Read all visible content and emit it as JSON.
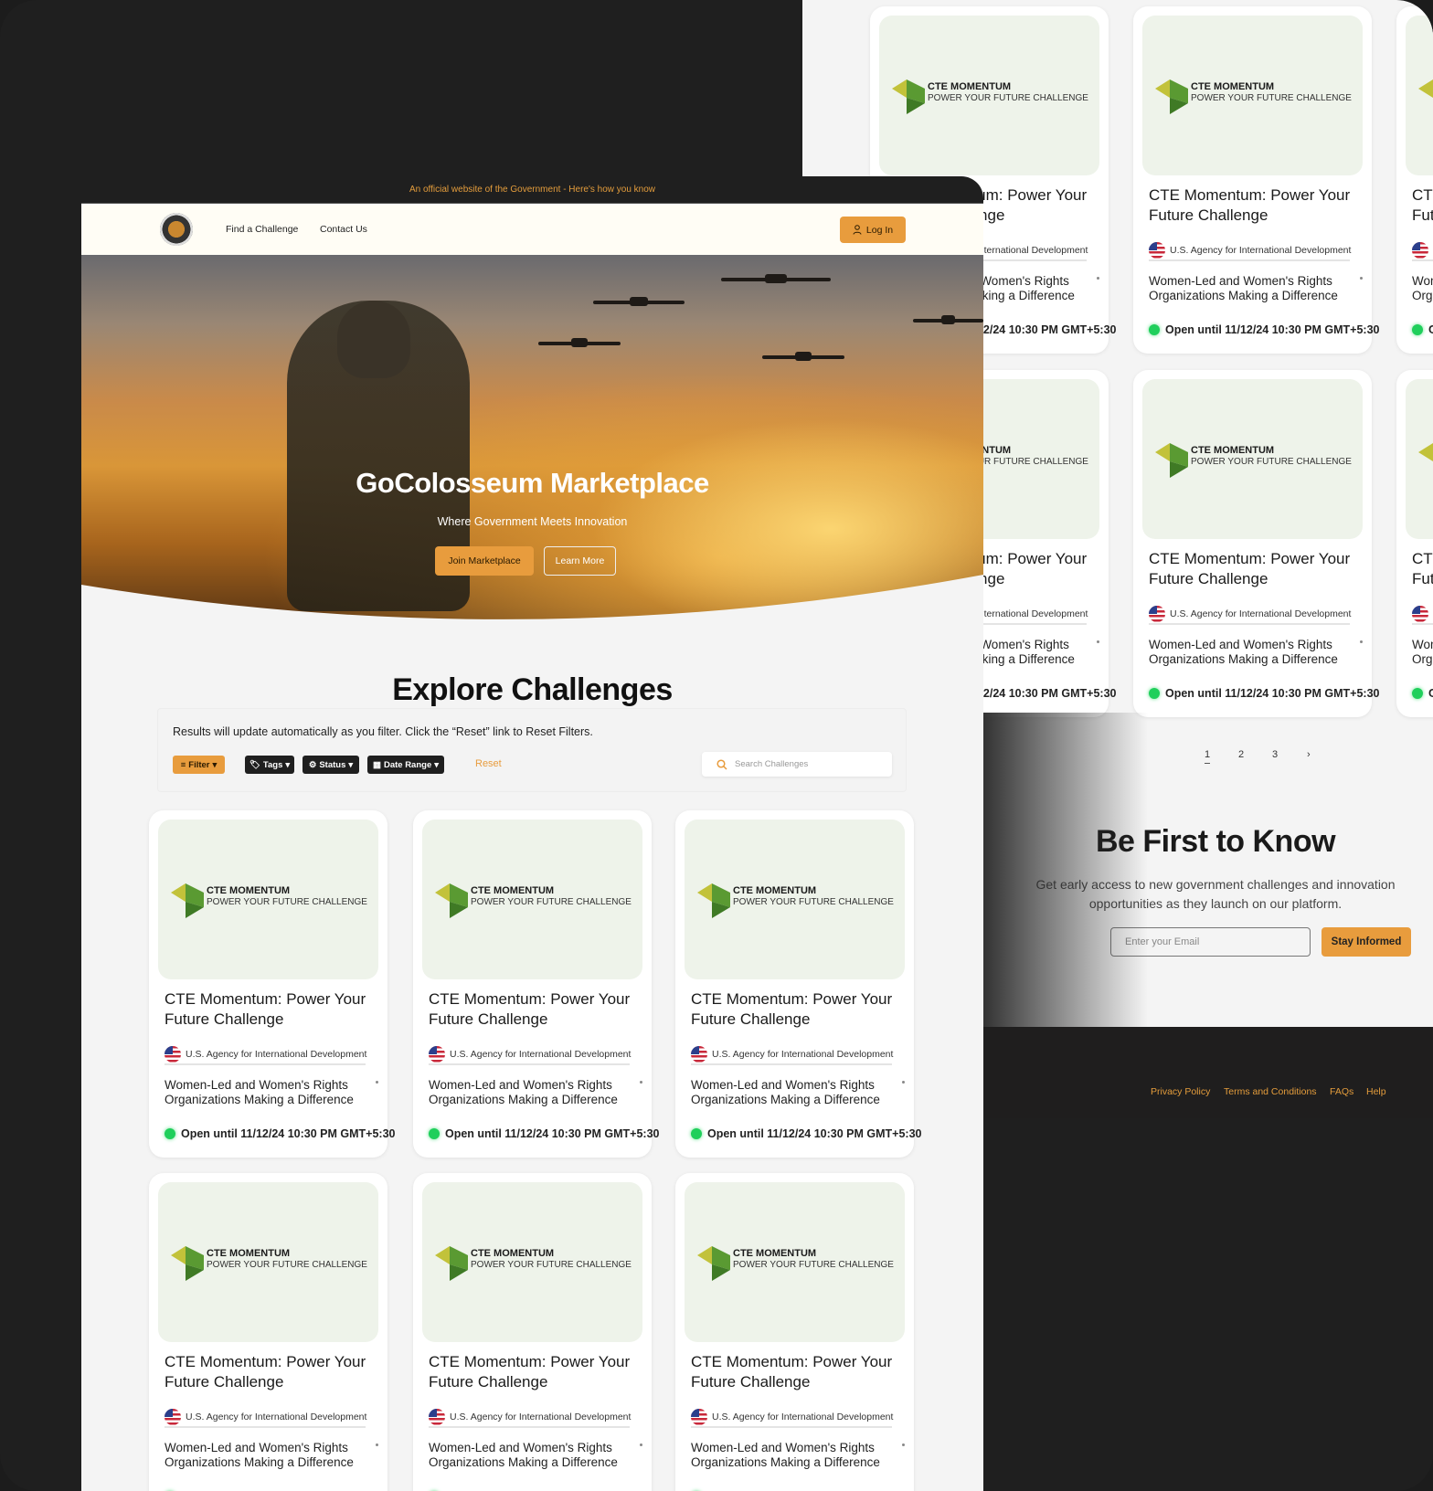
{
  "gov_banner": "An official website of the Government - Here's how you know",
  "nav": {
    "find": "Find a Challenge",
    "contact": "Contact Us",
    "login": "Log In"
  },
  "hero": {
    "title": "GoColosseum Marketplace",
    "subtitle": "Where Government Meets Innovation",
    "join": "Join Marketplace",
    "learn": "Learn More"
  },
  "explore": {
    "title": "Explore Challenges",
    "note": "Results will update automatically as you filter. Click the “Reset” link to Reset Filters.",
    "filters": [
      "Filter",
      "Tags",
      "Status",
      "Date Range"
    ],
    "reset": "Reset",
    "search_placeholder": "Search Challenges"
  },
  "card": {
    "logo_line1": "CTE MOMENTUM",
    "logo_line2": "POWER YOUR FUTURE CHALLENGE",
    "title": "CTE Momentum: Power Your Future  Challenge",
    "agency": "U.S. Agency for International Development",
    "description": "Women-Led and Women's Rights Organizations Making a Difference",
    "status": "Open until 11/12/24 10:30 PM GMT+5:30"
  },
  "front_card_count": 6,
  "back_card_count": 6,
  "pagination": {
    "pages": [
      "1",
      "2",
      "3"
    ],
    "current": "1",
    "next": "›"
  },
  "newsletter": {
    "title": "Be First to Know",
    "text": "Get early access to new government challenges and innovation opportunities as they launch on our platform.",
    "email_placeholder": "Enter your Email",
    "button": "Stay Informed"
  },
  "footer": {
    "links": [
      "Privacy Policy",
      "Terms and Conditions",
      "FAQs",
      "Help"
    ]
  },
  "colors": {
    "accent": "#e89c3d",
    "dark": "#1f1f1f",
    "status_open": "#1fcf5b"
  }
}
